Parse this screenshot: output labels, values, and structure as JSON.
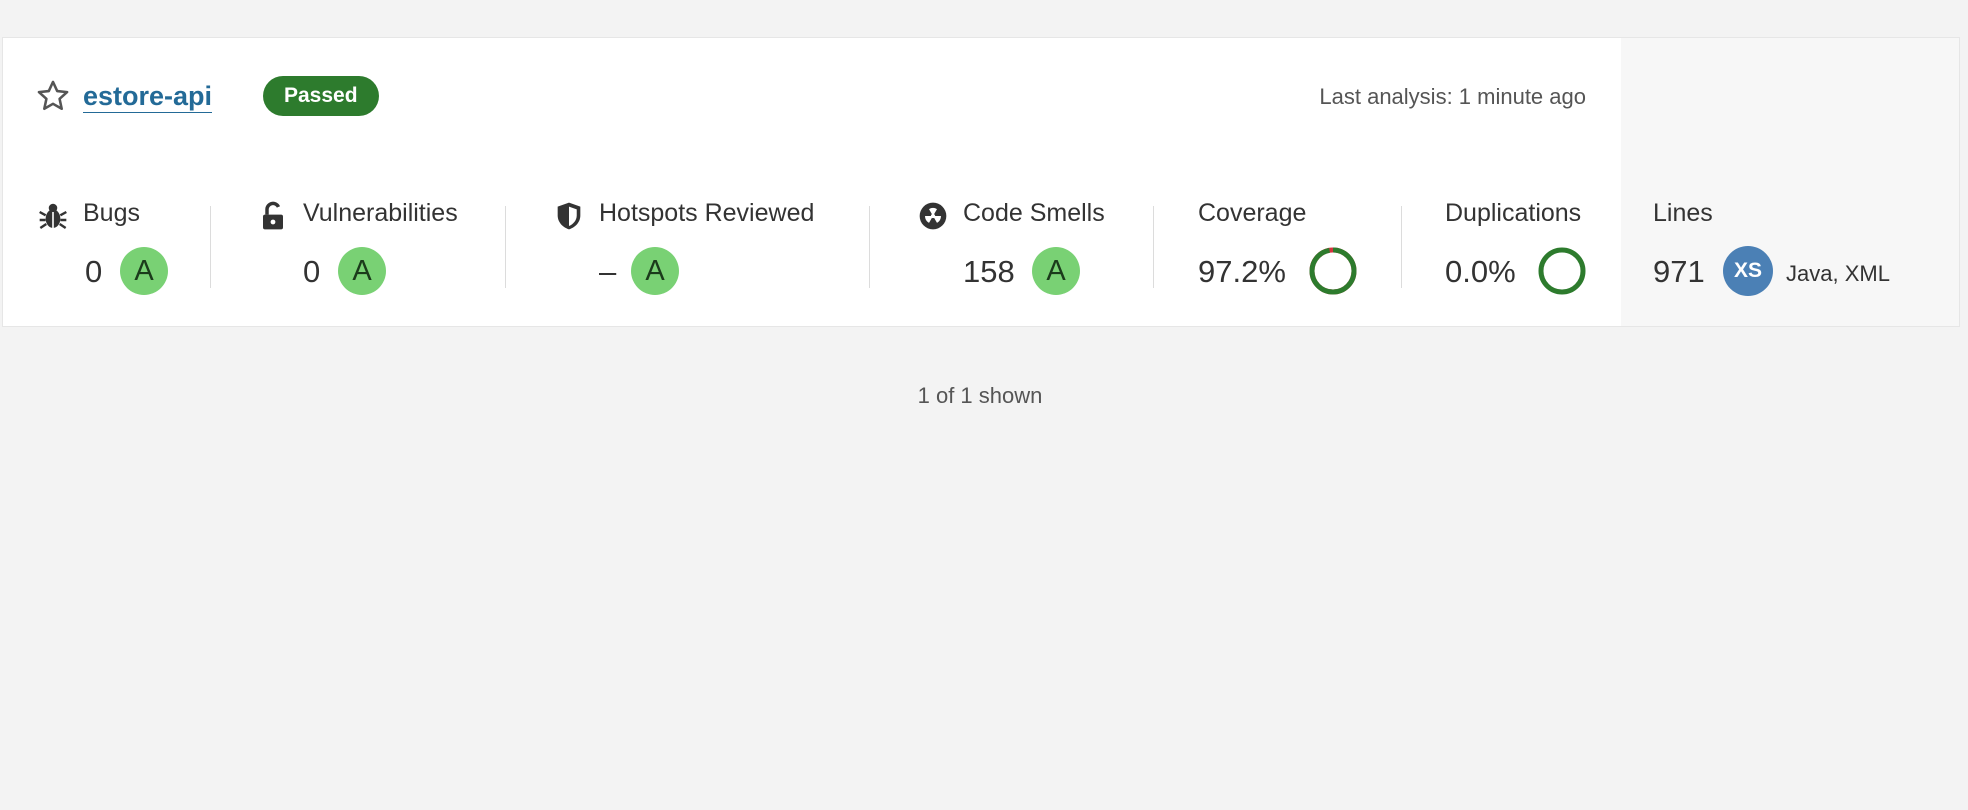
{
  "project": {
    "name": "estore-api",
    "quality_gate": "Passed",
    "last_analysis": "Last analysis: 1 minute ago"
  },
  "measures": {
    "bugs": {
      "label": "Bugs",
      "value": "0",
      "rating": "A"
    },
    "vulnerabilities": {
      "label": "Vulnerabilities",
      "value": "0",
      "rating": "A"
    },
    "hotspots": {
      "label": "Hotspots Reviewed",
      "value": "–",
      "rating": "A"
    },
    "code_smells": {
      "label": "Code Smells",
      "value": "158",
      "rating": "A"
    },
    "coverage": {
      "label": "Coverage",
      "value": "97.2%",
      "percent": 97.2
    },
    "duplications": {
      "label": "Duplications",
      "value": "0.0%",
      "percent": 0.0
    },
    "lines": {
      "label": "Lines",
      "value": "971",
      "size": "XS",
      "languages": "Java, XML"
    }
  },
  "footer": {
    "shown": "1 of 1 shown"
  },
  "colors": {
    "rating_a": "#79d174",
    "passed": "#2d7b2d",
    "link": "#236a97",
    "size_badge": "#4b80b5",
    "covered": "#2d7b2d",
    "uncovered": "#d4333f"
  },
  "icons": {
    "star": "star-icon",
    "bugs": "bug-icon",
    "vulnerabilities": "lock-open-icon",
    "hotspots": "shield-icon",
    "code_smells": "radiation-icon"
  }
}
